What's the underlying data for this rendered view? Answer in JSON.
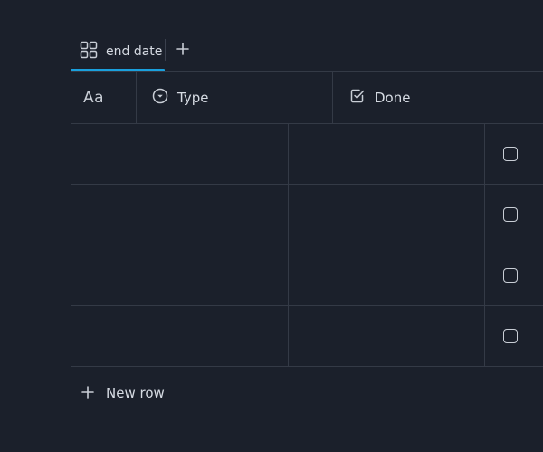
{
  "tabs": {
    "items": [
      {
        "label": "end date",
        "icon": "grid-icon",
        "active": true
      }
    ],
    "add_icon": "plus-icon"
  },
  "columns": {
    "title": {
      "label": "Aa"
    },
    "type": {
      "label": "Type",
      "icon": "select-circle-icon"
    },
    "done": {
      "label": "Done",
      "icon": "checkbox-icon"
    }
  },
  "rows": [
    {
      "title": "",
      "type": "",
      "done": false
    },
    {
      "title": "",
      "type": "",
      "done": false
    },
    {
      "title": "",
      "type": "",
      "done": false
    },
    {
      "title": "",
      "type": "",
      "done": false
    }
  ],
  "new_row": {
    "label": "New row",
    "icon": "plus-icon"
  },
  "colors": {
    "background": "#1b202b",
    "accent": "#1aa0dd",
    "border": "#343a46",
    "text": "#d6dbe3"
  }
}
